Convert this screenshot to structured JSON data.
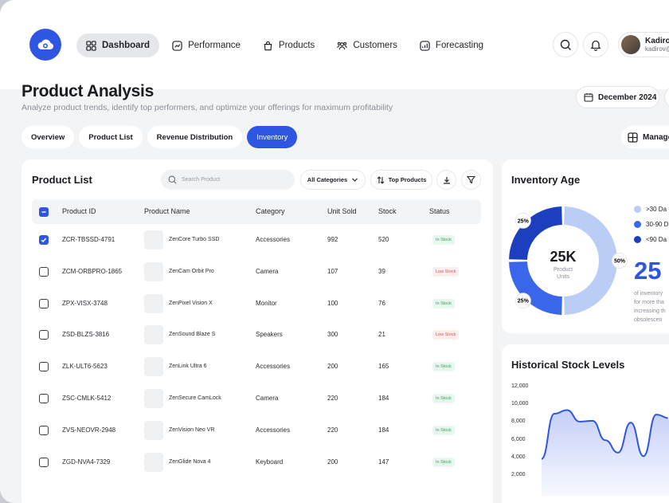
{
  "header": {
    "nav": [
      {
        "label": "Dashboard",
        "icon": "grid-icon",
        "active": true
      },
      {
        "label": "Performance",
        "icon": "chart-icon",
        "active": false
      },
      {
        "label": "Products",
        "icon": "bag-icon",
        "active": false
      },
      {
        "label": "Customers",
        "icon": "users-icon",
        "active": false
      },
      {
        "label": "Forecasting",
        "icon": "forecast-icon",
        "active": false
      }
    ],
    "user": {
      "name": "Kadirov",
      "email": "kadirov@"
    }
  },
  "page": {
    "title": "Product Analysis",
    "subtitle": "Analyze product trends, identify top performers, and optimize your offerings for maximum profitability",
    "date": "December 2024",
    "tabs": [
      "Overview",
      "Product List",
      "Revenue Distribution",
      "Inventory"
    ],
    "active_tab": "Inventory",
    "manage_label": "Manage"
  },
  "product_list": {
    "title": "Product List",
    "search_placeholder": "Search Product",
    "category_filter": "All Categories",
    "sort_label": "Top Products",
    "columns": [
      "Product ID",
      "Product Name",
      "Category",
      "Unit Sold",
      "Stock",
      "Status"
    ],
    "rows": [
      {
        "id": "ZCR-TBSSD-4791",
        "name": "ZenCore Turbo SSD",
        "category": "Accessories",
        "sold": "992",
        "stock": "520",
        "status": "In Stock",
        "checked": true
      },
      {
        "id": "ZCM-ORBPRO-1865",
        "name": "ZenCam Orbit Pro",
        "category": "Camera",
        "sold": "107",
        "stock": "39",
        "status": "Low Stock",
        "checked": false
      },
      {
        "id": "ZPX-VISX-3748",
        "name": "ZenPixel Vision X",
        "category": "Monitor",
        "sold": "100",
        "stock": "76",
        "status": "In Stock",
        "checked": false
      },
      {
        "id": "ZSD-BLZS-3816",
        "name": "ZenSound Blaze S",
        "category": "Speakers",
        "sold": "300",
        "stock": "21",
        "status": "Low Stock",
        "checked": false
      },
      {
        "id": "ZLK-ULT6-5623",
        "name": "ZenLink Ultra 6",
        "category": "Accessories",
        "sold": "200",
        "stock": "165",
        "status": "In Stock",
        "checked": false
      },
      {
        "id": "ZSC-CMLK-5412",
        "name": "ZenSecure CamLock",
        "category": "Camera",
        "sold": "220",
        "stock": "184",
        "status": "In Stock",
        "checked": false
      },
      {
        "id": "ZVS-NEOVR-2948",
        "name": "ZenVision Neo VR",
        "category": "Accessories",
        "sold": "220",
        "stock": "184",
        "status": "In Stock",
        "checked": false
      },
      {
        "id": "ZGD-NVA4-7329",
        "name": "ZenGlide Nova 4",
        "category": "Keyboard",
        "sold": "200",
        "stock": "147",
        "status": "In Stock",
        "checked": false
      }
    ]
  },
  "inventory_age": {
    "title": "Inventory Age",
    "center_value": "25K",
    "center_label_1": "Product",
    "center_label_2": "Units",
    "segments": [
      {
        "label": ">30 Da",
        "pct": 50,
        "pct_label": "50%",
        "color": "#b9cdf6"
      },
      {
        "label": "30-90 D",
        "pct": 25,
        "pct_label": "25%",
        "color": "#3a67ea"
      },
      {
        "label": "<90 Da",
        "pct": 25,
        "pct_label": "25%",
        "color": "#1c3fc0"
      }
    ],
    "highlight": "25",
    "note": [
      "of inventory",
      "for more tha",
      "increasing th",
      "obsolescen"
    ]
  },
  "historical": {
    "title": "Historical Stock Levels",
    "chart_data": {
      "type": "area",
      "y_ticks": [
        "12,000",
        "10,000",
        "8,000",
        "6,000",
        "4,000",
        "2,000"
      ],
      "ylim": [
        2000,
        12000
      ],
      "values": [
        4200,
        9300,
        9700,
        8400,
        8500,
        6300,
        4900,
        8300,
        4500,
        9200,
        8800,
        9100
      ],
      "color": "#2f55e3"
    }
  },
  "colors": {
    "accent": "#2f55e3",
    "in_stock": "#2ea55a",
    "low_stock": "#e35151"
  }
}
